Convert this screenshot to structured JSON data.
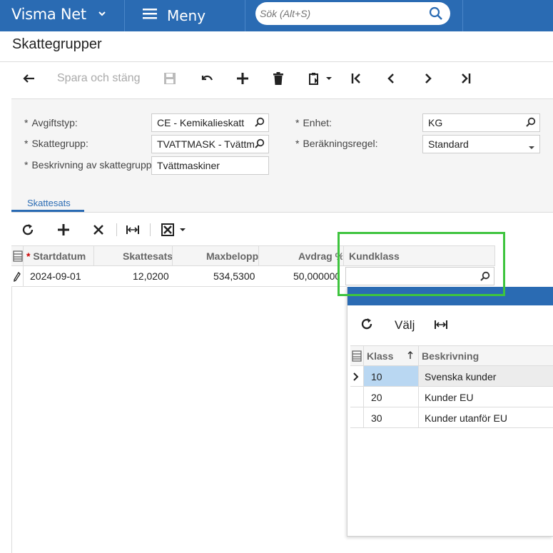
{
  "topbar": {
    "brand": "Visma Net",
    "menu_label": "Meny",
    "search_placeholder": "Sök (Alt+S)"
  },
  "page_title": "Skattegrupper",
  "toolbar": {
    "save_close_label": "Spara och stäng"
  },
  "form": {
    "avgiftstyp_label": "Avgiftstyp:",
    "avgiftstyp_value": "CE - Kemikalieskatt",
    "skattegrupp_label": "Skattegrupp:",
    "skattegrupp_value": "TVATTMASK - Tvättma",
    "beskrivning_label": "Beskrivning av skattegrupp:",
    "beskrivning_value": "Tvättmaskiner",
    "enhet_label": "Enhet:",
    "enhet_value": "KG",
    "berakningsregel_label": "Beräkningsregel:",
    "berakningsregel_value": "Standard"
  },
  "tabs": [
    {
      "label": "Skattesats"
    }
  ],
  "grid": {
    "columns": [
      "Startdatum",
      "Skattesats",
      "Maxbelopp",
      "Avdrag %",
      "Kundklass"
    ],
    "rows": [
      {
        "startdatum": "2024-09-01",
        "skattesats": "12,0200",
        "maxbelopp": "534,5300",
        "avdrag": "50,000000",
        "kundklass": ""
      }
    ]
  },
  "popup": {
    "select_label": "Välj",
    "columns": [
      "Klass",
      "Beskrivning"
    ],
    "rows": [
      {
        "klass": "10",
        "beskrivning": "Svenska kunder"
      },
      {
        "klass": "20",
        "beskrivning": "Kunder EU"
      },
      {
        "klass": "30",
        "beskrivning": "Kunder utanför EU"
      }
    ]
  },
  "colors": {
    "brand": "#2a6bb3",
    "highlight": "#3ec43e",
    "selected_cell": "#b9d7f2"
  }
}
